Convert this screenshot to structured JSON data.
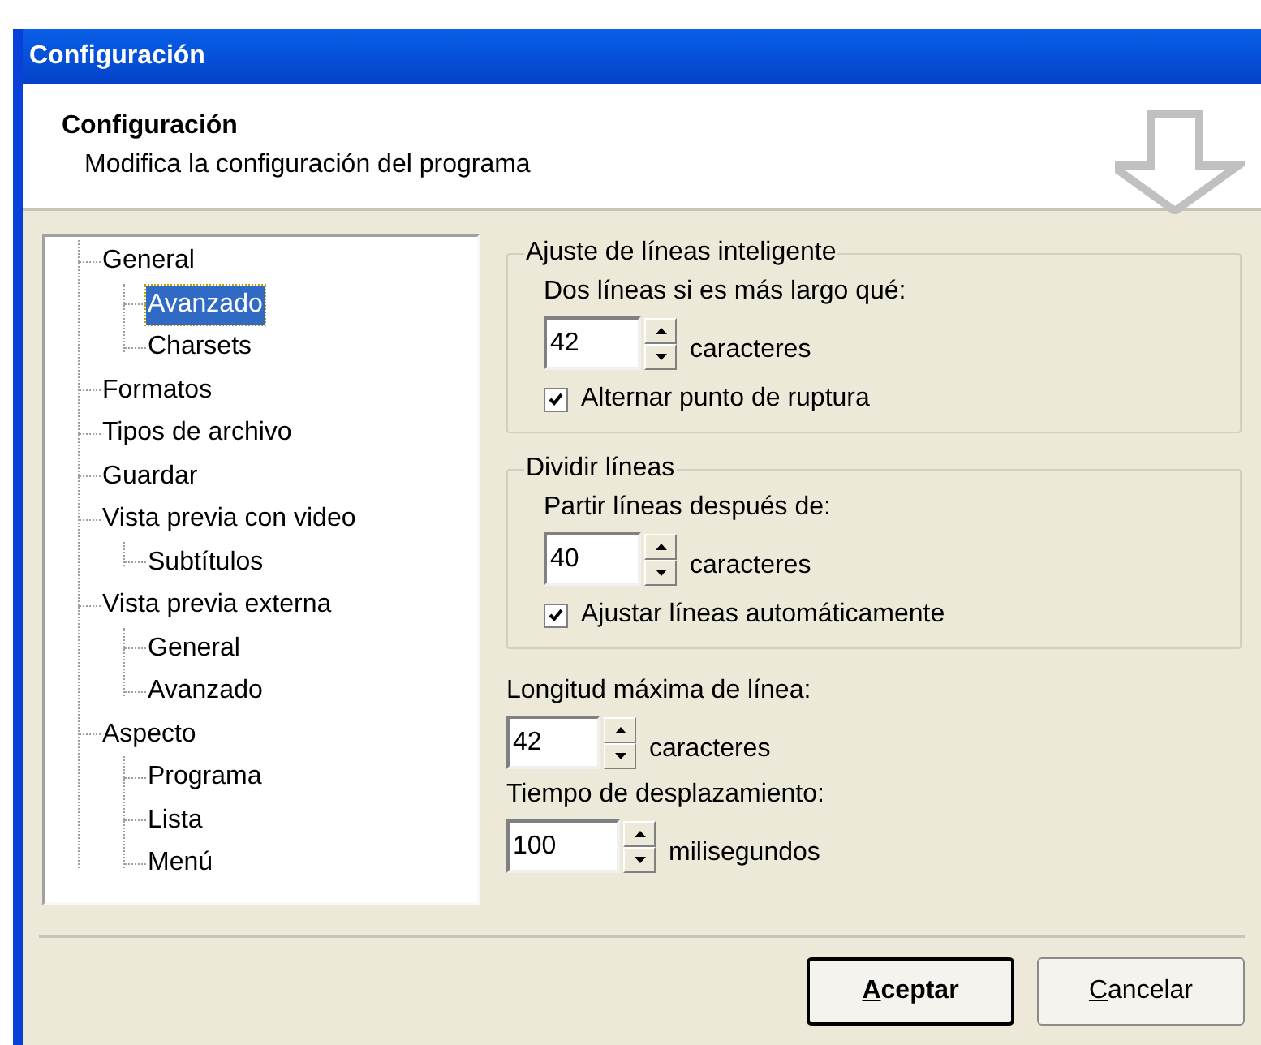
{
  "window": {
    "title": "Configuración"
  },
  "header": {
    "title": "Configuración",
    "subtitle": "Modifica la configuración del programa"
  },
  "tree": [
    {
      "label": "General",
      "selected": false,
      "children": [
        {
          "label": "Avanzado",
          "selected": true
        },
        {
          "label": "Charsets",
          "selected": false
        }
      ]
    },
    {
      "label": "Formatos",
      "selected": false
    },
    {
      "label": "Tipos de archivo",
      "selected": false
    },
    {
      "label": "Guardar",
      "selected": false
    },
    {
      "label": "Vista previa con video",
      "selected": false,
      "children": [
        {
          "label": "Subtítulos",
          "selected": false
        }
      ]
    },
    {
      "label": "Vista previa externa",
      "selected": false,
      "children": [
        {
          "label": "General",
          "selected": false
        },
        {
          "label": "Avanzado",
          "selected": false
        }
      ]
    },
    {
      "label": "Aspecto",
      "selected": false,
      "children": [
        {
          "label": "Programa",
          "selected": false
        },
        {
          "label": "Lista",
          "selected": false
        },
        {
          "label": "Menú",
          "selected": false
        }
      ]
    }
  ],
  "groups": [
    {
      "title": "Ajuste de líneas inteligente",
      "label": "Dos líneas si es más largo qué:",
      "value": "42",
      "unit": "caracteres",
      "checkbox": {
        "label": "Alternar punto de ruptura",
        "checked": true
      }
    },
    {
      "title": "Dividir líneas",
      "label": "Partir líneas después de:",
      "value": "40",
      "unit": "caracteres",
      "checkbox": {
        "label": "Ajustar líneas automáticamente",
        "checked": true
      }
    }
  ],
  "fields": [
    {
      "label": "Longitud máxima de línea:",
      "value": "42",
      "unit": "caracteres"
    },
    {
      "label": "Tiempo de desplazamiento:",
      "value": "100",
      "unit": "milisegundos"
    }
  ],
  "buttons": [
    {
      "label": "Aceptar",
      "default": true
    },
    {
      "label": "Cancelar",
      "default": false
    }
  ]
}
